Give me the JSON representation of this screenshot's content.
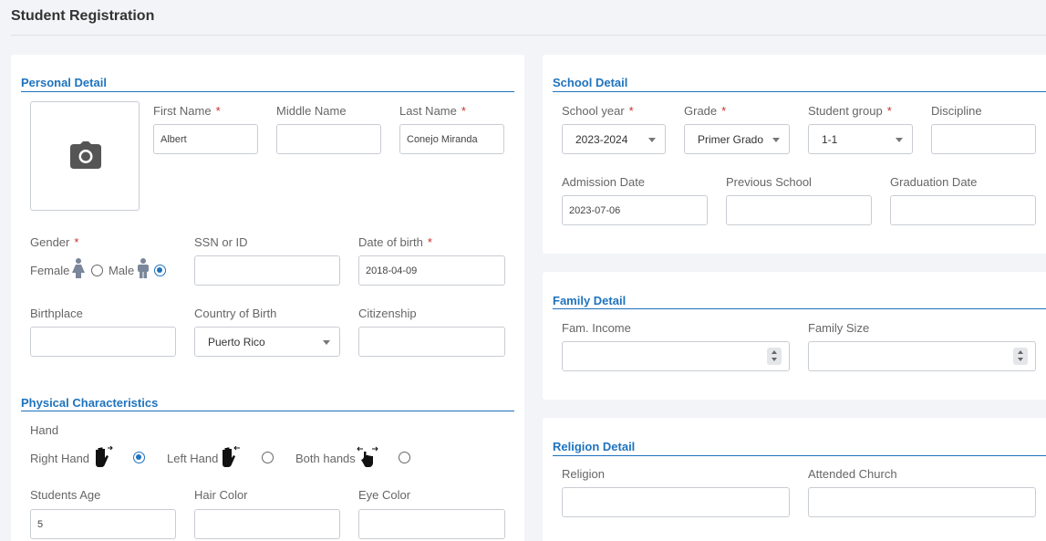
{
  "page_title": "Student Registration",
  "personal": {
    "title": "Personal Detail",
    "photo_icon": "camera-icon",
    "first_name": {
      "label": "First Name",
      "required": "*",
      "value": "Albert"
    },
    "middle_name": {
      "label": "Middle Name",
      "value": ""
    },
    "last_name": {
      "label": "Last Name",
      "required": "*",
      "value": "Conejo Miranda"
    },
    "gender": {
      "label": "Gender",
      "required": "*",
      "female_label": "Female",
      "male_label": "Male",
      "selected": "Male"
    },
    "ssn": {
      "label": "SSN or ID",
      "value": ""
    },
    "dob": {
      "label": "Date of birth",
      "required": "*",
      "value": "2018-04-09"
    },
    "birthplace": {
      "label": "Birthplace",
      "value": ""
    },
    "country": {
      "label": "Country of Birth",
      "value": "Puerto Rico"
    },
    "citizenship": {
      "label": "Citizenship",
      "value": ""
    }
  },
  "physical": {
    "title": "Physical Characteristics",
    "hand_label": "Hand",
    "right_hand": "Right Hand",
    "left_hand": "Left Hand",
    "both_hands": "Both hands",
    "selected_hand": "Right Hand",
    "age": {
      "label": "Students Age",
      "value": "5"
    },
    "hair": {
      "label": "Hair Color",
      "value": ""
    },
    "eye": {
      "label": "Eye Color",
      "value": ""
    }
  },
  "school": {
    "title": "School Detail",
    "school_year": {
      "label": "School year",
      "required": "*",
      "value": "2023-2024"
    },
    "grade": {
      "label": "Grade",
      "required": "*",
      "value": "Primer Grado"
    },
    "group": {
      "label": "Student group",
      "required": "*",
      "value": "1-1"
    },
    "discipline": {
      "label": "Discipline",
      "value": ""
    },
    "admission": {
      "label": "Admission Date",
      "value": "2023-07-06"
    },
    "previous_school": {
      "label": "Previous School",
      "value": ""
    },
    "graduation": {
      "label": "Graduation Date",
      "value": ""
    }
  },
  "family": {
    "title": "Family Detail",
    "income": {
      "label": "Fam. Income",
      "value": ""
    },
    "size": {
      "label": "Family Size",
      "value": ""
    }
  },
  "religion": {
    "title": "Religion Detail",
    "religion": {
      "label": "Religion",
      "value": ""
    },
    "church": {
      "label": "Attended Church",
      "value": ""
    }
  },
  "colors": {
    "accent": "#1e73be",
    "required": "#c9302c",
    "border": "#c8cdd3",
    "background": "#f2f4f7"
  }
}
